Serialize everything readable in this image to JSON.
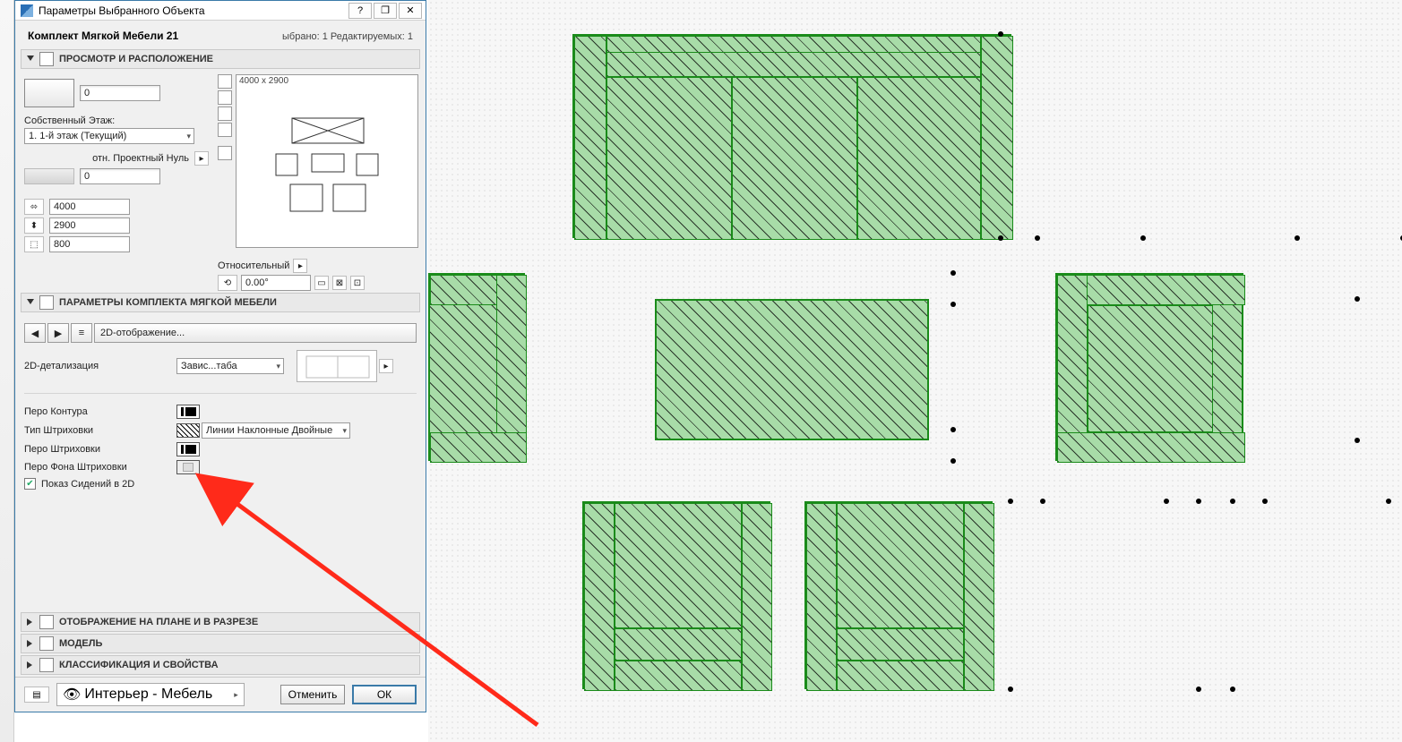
{
  "dialog": {
    "title": "Параметры Выбранного Объекта",
    "object_name": "Комплект Мягкой Мебели 21",
    "selection_status": "ыбрано: 1 Редактируемых: 1"
  },
  "preview_section": {
    "header": "ПРОСМОТР И РАСПОЛОЖЕНИЕ",
    "elevation_value": "0",
    "home_story_label": "Собственный Этаж:",
    "home_story_value": "1. 1-й этаж (Текущий)",
    "project_zero_label": "отн. Проектный Нуль",
    "project_zero_value": "0",
    "dim_a": "4000",
    "dim_b": "2900",
    "dim_h": "800",
    "preview_dims": "4000 x 2900",
    "rel_label": "Относительный",
    "angle": "0.00°"
  },
  "params_section": {
    "header": "ПАРАМЕТРЫ КОМПЛЕКТА МЯГКОЙ МЕБЕЛИ",
    "page_name": "2D-отображение...",
    "detail_label": "2D-детализация",
    "detail_value": "Завис...таба",
    "pen_contour": "Перо Контура",
    "hatch_type": "Тип Штриховки",
    "hatch_type_value": "Линии Наклонные Двойные",
    "pen_hatch": "Перо Штриховки",
    "pen_hatch_bg": "Перо Фона Штриховки",
    "show_seat_2d": "Показ Сидений в 2D"
  },
  "collapsed_sections": {
    "plan_section": "ОТОБРАЖЕНИЕ НА ПЛАНЕ И В РАЗРЕЗЕ",
    "model": "МОДЕЛЬ",
    "classification": "КЛАССИФИКАЦИЯ И СВОЙСТВА"
  },
  "footer": {
    "layer": "Интерьер - Мебель",
    "cancel": "Отменить",
    "ok": "ОК"
  }
}
